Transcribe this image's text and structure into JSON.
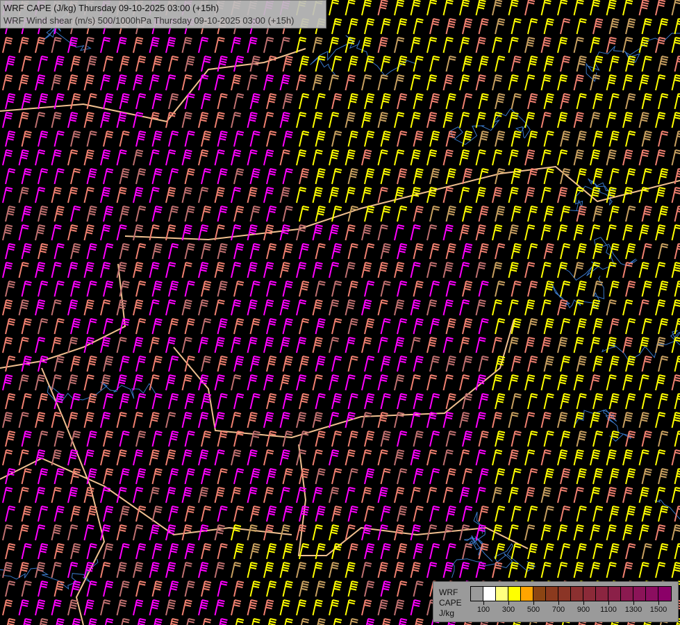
{
  "header": {
    "title_line1": "WRF CAPE (J/kg) Thursday 09-10-2025 03:00 (+15h)",
    "title_line2": "WRF Wind shear (m/s) 500/1000hPa Thursday 09-10-2025 03:00 (+15h)"
  },
  "legend": {
    "label_line1": "WRF",
    "label_line2": "CAPE",
    "label_line3": "J/kg",
    "colors": [
      "#9a9a9a",
      "#ffffff",
      "#ffff80",
      "#ffff00",
      "#ffa500",
      "#8b4513",
      "#8b3a1e",
      "#8b3526",
      "#8b3030",
      "#8b2a38",
      "#8b2540",
      "#8b2048",
      "#8b1a50",
      "#8b1458",
      "#8b0e60",
      "#8b0068"
    ],
    "ticks": [
      "100",
      "300",
      "500",
      "700",
      "900",
      "1100",
      "1300",
      "1500"
    ]
  },
  "map": {
    "barb_colors": {
      "magenta": "#ff00ff",
      "salmon": "#f08070",
      "rose": "#c07070",
      "yellow": "#ffff00",
      "tan": "#c8a060"
    },
    "border_color": "#f0c090",
    "river_color": "#3a78c8"
  }
}
